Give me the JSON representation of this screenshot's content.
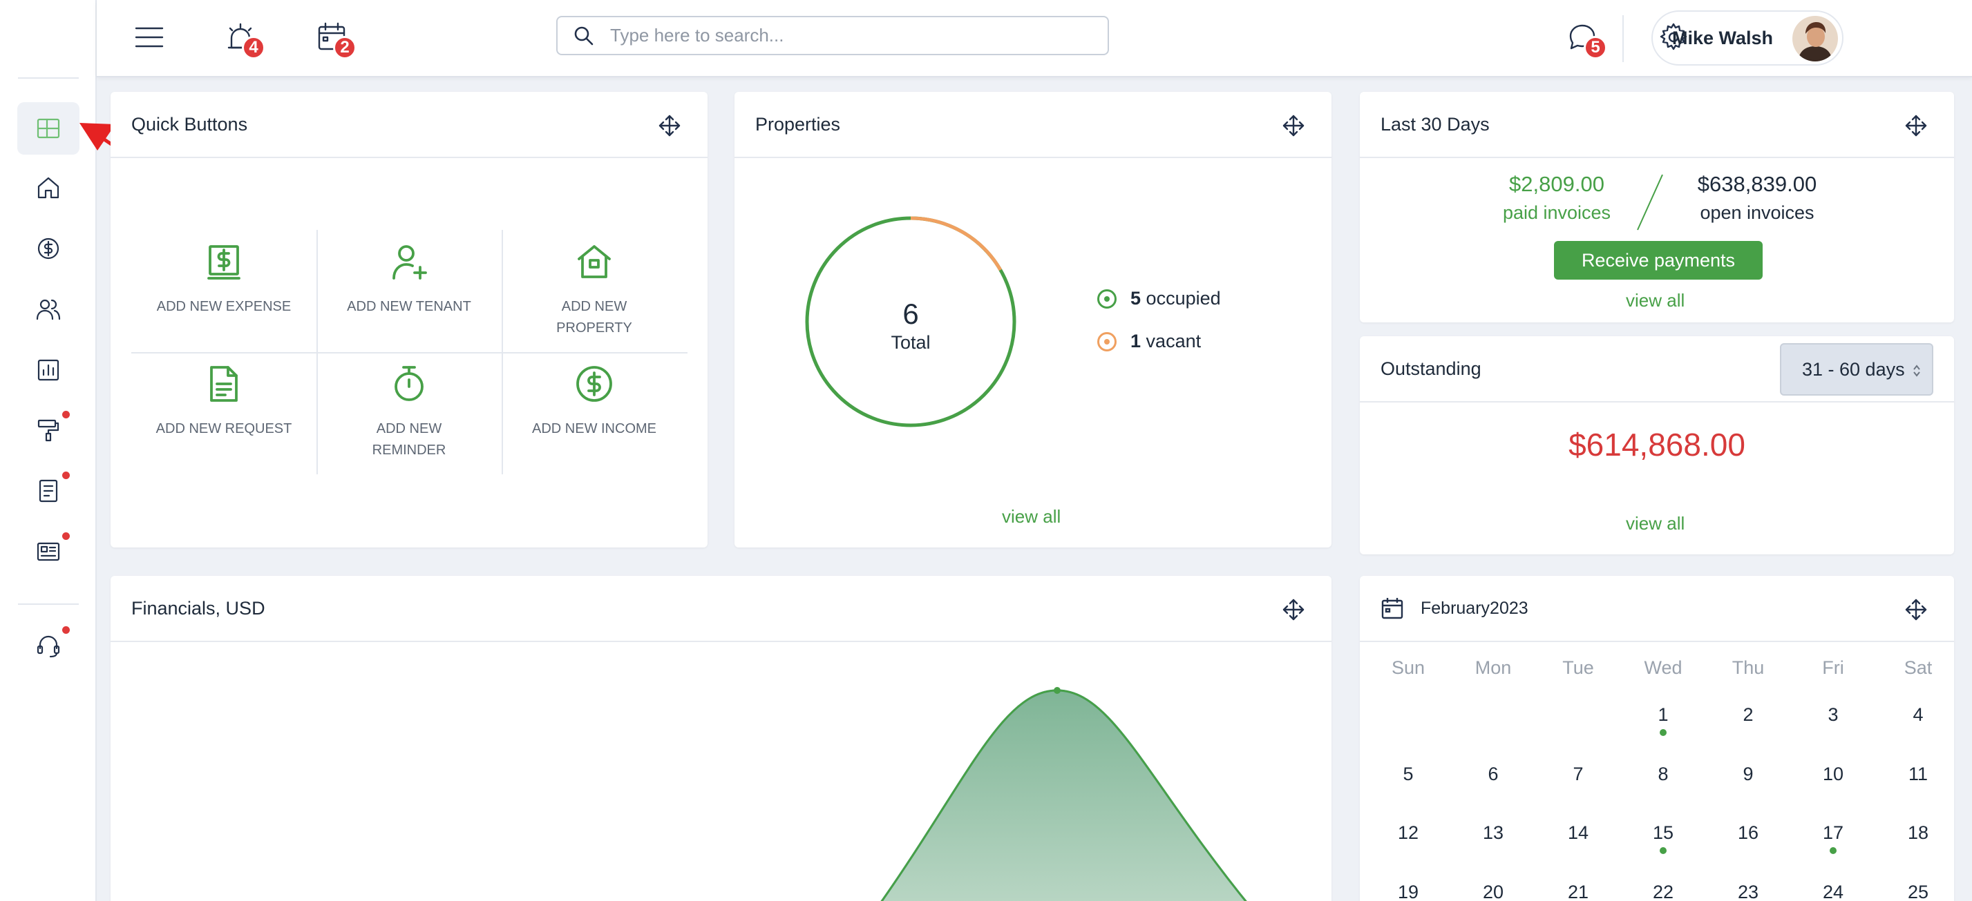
{
  "header": {
    "menu_icon": "hamburger-icon",
    "alarm_badge": "4",
    "calendar_badge": "2",
    "search_placeholder": "Type here to search...",
    "chat_badge": "5",
    "user_name": "Mike Walsh"
  },
  "sidebar": {
    "items": [
      {
        "icon": "dashboard-icon",
        "active": true
      },
      {
        "icon": "home-icon"
      },
      {
        "icon": "dollar-icon"
      },
      {
        "icon": "users-icon"
      },
      {
        "icon": "chart-icon"
      },
      {
        "icon": "paint-roller-icon",
        "dot": true
      },
      {
        "icon": "document-icon",
        "dot": true
      },
      {
        "icon": "news-icon",
        "dot": true
      },
      {
        "icon": "headset-icon",
        "dot": true
      }
    ]
  },
  "quick_buttons": {
    "title": "Quick Buttons",
    "items": [
      {
        "label": "ADD NEW EXPENSE",
        "icon": "expense-icon"
      },
      {
        "label": "ADD NEW TENANT",
        "icon": "add-user-icon"
      },
      {
        "label": "ADD NEW PROPERTY",
        "icon": "house-icon"
      },
      {
        "label": "ADD NEW REQUEST",
        "icon": "request-doc-icon"
      },
      {
        "label": "ADD NEW REMINDER",
        "icon": "stopwatch-icon"
      },
      {
        "label": "ADD NEW INCOME",
        "icon": "income-coin-icon"
      }
    ]
  },
  "properties": {
    "title": "Properties",
    "total_value": "6",
    "total_label": "Total",
    "occupied_count": "5",
    "occupied_label": "occupied",
    "vacant_count": "1",
    "vacant_label": "vacant",
    "view_all": "view all",
    "colors": {
      "occupied": "#47a047",
      "vacant": "#f0a060"
    }
  },
  "last30": {
    "title": "Last 30 Days",
    "paid_amount": "$2,809.00",
    "paid_label": "paid invoices",
    "open_amount": "$638,839.00",
    "open_label": "open invoices",
    "button": "Receive payments",
    "view_all": "view all"
  },
  "outstanding": {
    "title": "Outstanding",
    "range": "31 - 60 days",
    "amount": "$614,868.00",
    "view_all": "view all"
  },
  "financials": {
    "title": "Financials, USD"
  },
  "calendar": {
    "title": "February2023",
    "dow": [
      "Sun",
      "Mon",
      "Tue",
      "Wed",
      "Thu",
      "Fri",
      "Sat"
    ],
    "weeks": [
      [
        "",
        "",
        "",
        "1",
        "2",
        "3",
        "4"
      ],
      [
        "5",
        "6",
        "7",
        "8",
        "9",
        "10",
        "11"
      ],
      [
        "12",
        "13",
        "14",
        "15",
        "16",
        "17",
        "18"
      ],
      [
        "19",
        "20",
        "21",
        "22",
        "23",
        "24",
        "25"
      ]
    ],
    "event_days": [
      "1",
      "15",
      "17"
    ]
  },
  "colors": {
    "accent": "#47a047",
    "danger": "#e03a3a",
    "navy": "#1e2a3a"
  }
}
